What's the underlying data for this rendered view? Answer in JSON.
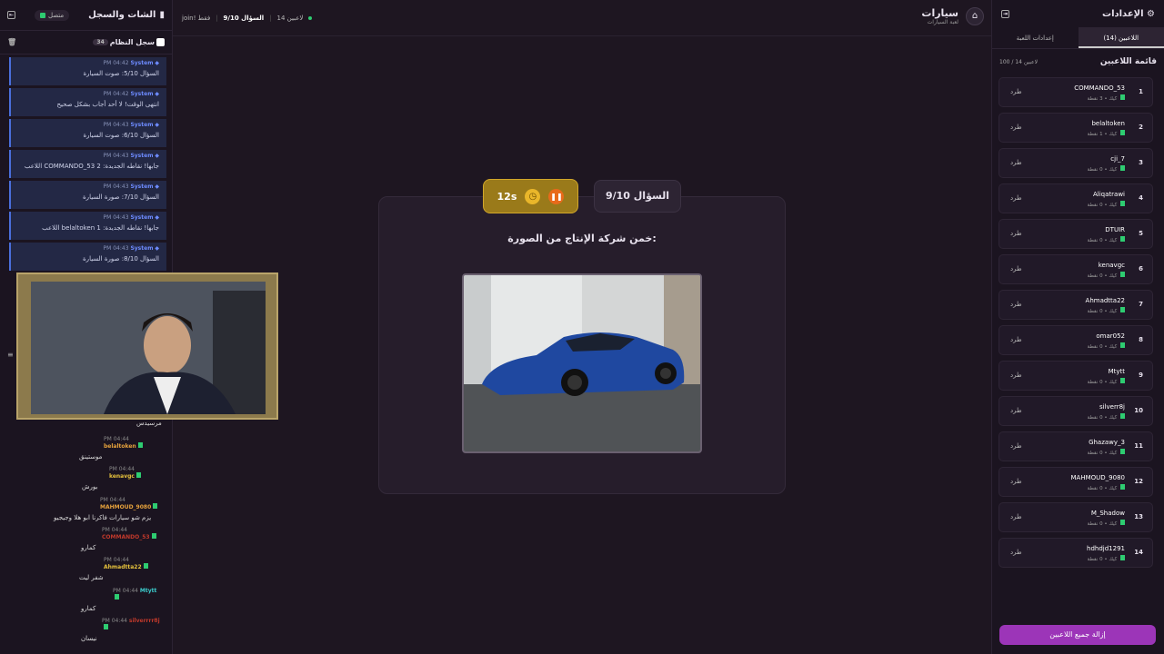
{
  "chat": {
    "title": "الشات والسجل",
    "status": "متصل",
    "system_log_title": "سجل النظام",
    "system_log_count": "34",
    "system_messages": [
      {
        "sender": "System",
        "time": "PM 04:42",
        "text": "السؤال 5/10: صوت السيارة"
      },
      {
        "sender": "System",
        "time": "PM 04:42",
        "text": "انتهى الوقت! لا أحد أجاب بشكل صحيح"
      },
      {
        "sender": "System",
        "time": "PM 04:43",
        "text": "السؤال 6/10: صوت السيارة"
      },
      {
        "sender": "System",
        "time": "PM 04:43",
        "text": "اللاعب COMMANDO_53 جابها! نقاطه الجديدة: 2"
      },
      {
        "sender": "System",
        "time": "PM 04:43",
        "text": "السؤال 7/10: صورة السيارة"
      },
      {
        "sender": "System",
        "time": "PM 04:43",
        "text": "اللاعب belaltoken جابها! نقاطه الجديدة: 1"
      },
      {
        "sender": "System",
        "time": "PM 04:43",
        "text": "السؤال 8/10: صورة السيارة"
      }
    ],
    "partial_text": "مرسيدس",
    "user_messages": [
      {
        "user": "belaltoken",
        "color": "#e6a23c",
        "time": "PM 04:44",
        "text": "موستينق"
      },
      {
        "user": "kenavgc",
        "color": "#e6c23c",
        "time": "PM 04:44",
        "text": "بورش"
      },
      {
        "user": "MAHMOUD_9080",
        "color": "#e6a23c",
        "time": "PM 04:44",
        "text": "يزم شو سيارات فاكرنا ابو هلا وجيجيو"
      },
      {
        "user": "COMMANDO_53",
        "color": "#c0392b",
        "time": "PM 04:44",
        "text": "كمارو"
      },
      {
        "user": "Ahmadtta22",
        "color": "#e6c23c",
        "time": "PM 04:44",
        "text": "شفر ليت"
      },
      {
        "user": "Mtytt",
        "color": "#3ccfcf",
        "time": "PM 04:44",
        "text": "كمارو"
      },
      {
        "user": "silverrrr8j",
        "color": "#c0392b",
        "time": "PM 04:44",
        "text": "نيسان"
      }
    ]
  },
  "topbar": {
    "players": "14 لاعبين",
    "question": "السؤال 9/10",
    "mode": "join! فقط",
    "title": "سيارات",
    "subtitle": "لعبة السيارات"
  },
  "game": {
    "question_badge": "السؤال 9/10",
    "timer": "12s",
    "question_text": "خمن شركة الإنتاج من الصورة:"
  },
  "settings": {
    "title": "الإعدادات",
    "tab_players": "اللاعبين (14)",
    "tab_game": "إعدادات اللعبة",
    "list_title": "قائمة اللاعبين",
    "list_count": "100 / 14 لاعبين",
    "kick_label": "طرد",
    "clear_button": "إزالة جميع اللاعبين",
    "players": [
      {
        "rank": "1",
        "name": "COMMANDO_53",
        "info": "كيك • 3 نقطة"
      },
      {
        "rank": "2",
        "name": "belaltoken",
        "info": "كيك • 1 نقطة"
      },
      {
        "rank": "3",
        "name": "cji_7",
        "info": "كيك • 0 نقطة"
      },
      {
        "rank": "4",
        "name": "Aliqatrawi",
        "info": "كيك • 0 نقطة"
      },
      {
        "rank": "5",
        "name": "DTUIR",
        "info": "كيك • 0 نقطة"
      },
      {
        "rank": "6",
        "name": "kenavgc",
        "info": "كيك • 0 نقطة"
      },
      {
        "rank": "7",
        "name": "Ahmadtta22",
        "info": "كيك • 0 نقطة"
      },
      {
        "rank": "8",
        "name": "omar052",
        "info": "كيك • 0 نقطة"
      },
      {
        "rank": "9",
        "name": "Mtytt",
        "info": "كيك • 0 نقطة"
      },
      {
        "rank": "10",
        "name": "silverr8j",
        "info": "كيك • 0 نقطة"
      },
      {
        "rank": "11",
        "name": "Ghazawy_3",
        "info": "كيك • 0 نقطة"
      },
      {
        "rank": "12",
        "name": "MAHMOUD_9080",
        "info": "كيك • 0 نقطة"
      },
      {
        "rank": "13",
        "name": "M_Shadow",
        "info": "كيك • 0 نقطة"
      },
      {
        "rank": "14",
        "name": "hdhdjd1291",
        "info": "كيك • 0 نقطة"
      }
    ]
  }
}
